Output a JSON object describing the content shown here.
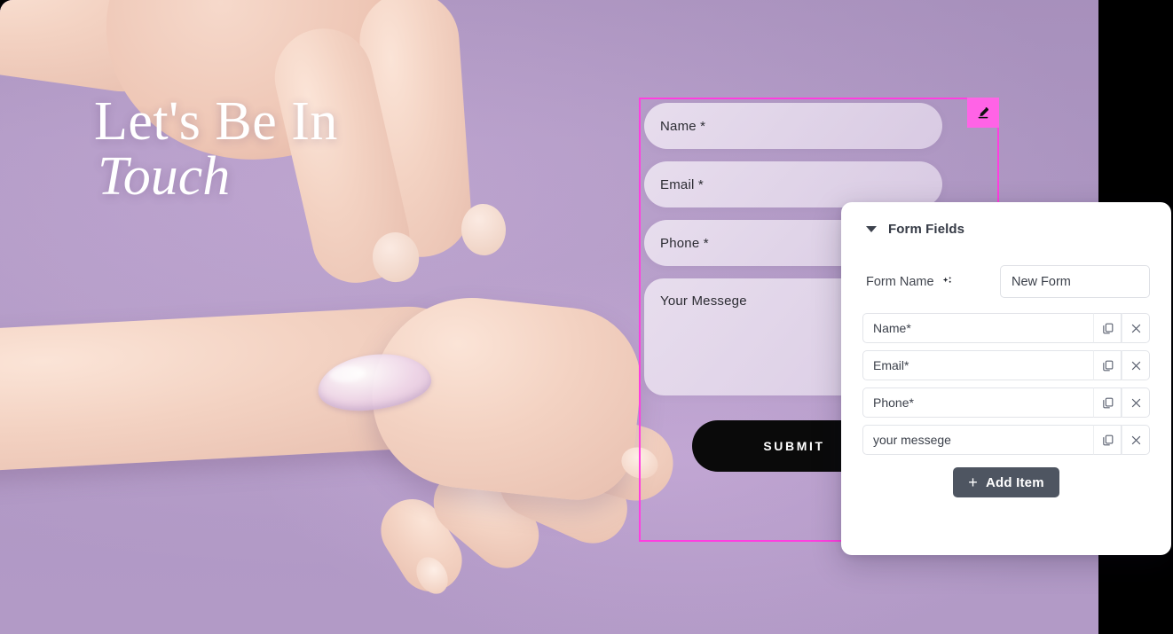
{
  "site": {
    "headline_line1": "Let's Be In",
    "headline_line2": "Touch",
    "form": {
      "name_placeholder": "Name *",
      "email_placeholder": "Email *",
      "phone_placeholder": "Phone *",
      "message_placeholder": "Your Messege",
      "submit_label": "SUBMIT",
      "edit_icon": "pencil-icon",
      "selection_color": "#ff3ee0",
      "edit_badge_color": "#ff63e6"
    }
  },
  "panel": {
    "title": "Form Fields",
    "caret_icon": "caret-down-icon",
    "form_name": {
      "label": "Form Name",
      "ai_icon": "sparkle-icon",
      "value": "New Form"
    },
    "items": [
      {
        "value": "Name*",
        "copy_icon": "copy-icon",
        "delete_icon": "close-icon"
      },
      {
        "value": "Email*",
        "copy_icon": "copy-icon",
        "delete_icon": "close-icon"
      },
      {
        "value": "Phone*",
        "copy_icon": "copy-icon",
        "delete_icon": "close-icon"
      },
      {
        "value": "your messege",
        "copy_icon": "copy-icon",
        "delete_icon": "close-icon"
      }
    ],
    "add_button": {
      "label": "Add Item",
      "plus": "+",
      "color": "#4e5561"
    }
  }
}
